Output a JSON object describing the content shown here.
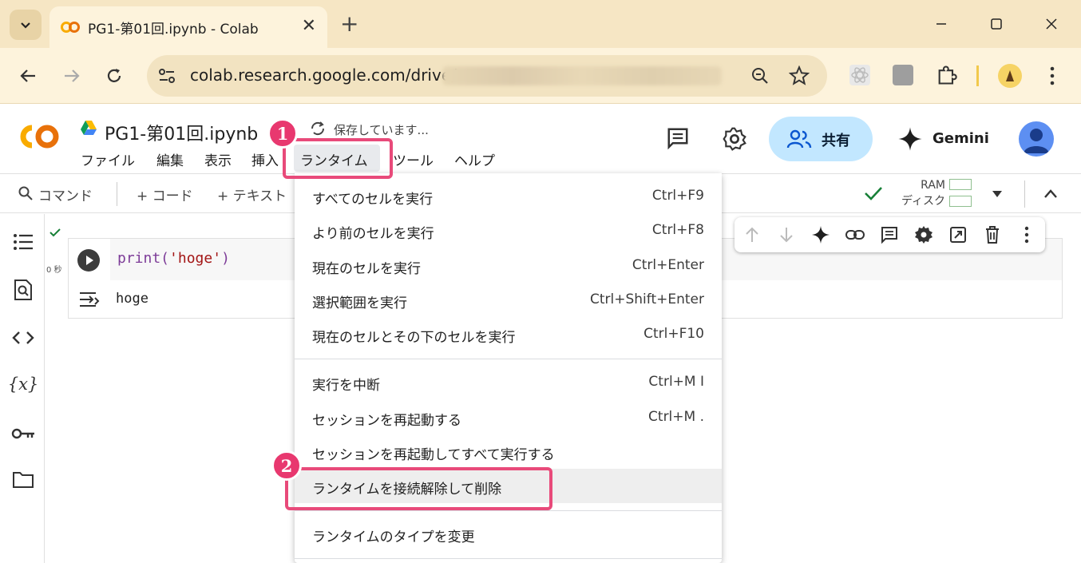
{
  "browser": {
    "tab_title": "PG1-第01回.ipynb - Colab",
    "url": "colab.research.google.com/drive/"
  },
  "notebook": {
    "title": "PG1-第01回.ipynb",
    "saving_status": "保存しています...",
    "menus": [
      "ファイル",
      "編集",
      "表示",
      "挿入",
      "ランタイム",
      "ツール",
      "ヘルプ"
    ],
    "share_label": "共有",
    "gemini_label": "Gemini"
  },
  "toolbar": {
    "command": "コマンド",
    "code": "+ コード",
    "text": "+ テキスト",
    "ram": "RAM",
    "disk": "ディスク"
  },
  "cell": {
    "exec_time": "0 秒",
    "code_fn": "print(",
    "code_str": "'hoge'",
    "code_end": ")",
    "output": "hoge"
  },
  "dropdown": {
    "items": [
      {
        "label": "すべてのセルを実行",
        "shortcut": "Ctrl+F9"
      },
      {
        "label": "より前のセルを実行",
        "shortcut": "Ctrl+F8"
      },
      {
        "label": "現在のセルを実行",
        "shortcut": "Ctrl+Enter"
      },
      {
        "label": "選択範囲を実行",
        "shortcut": "Ctrl+Shift+Enter"
      },
      {
        "label": "現在のセルとその下のセルを実行",
        "shortcut": "Ctrl+F10"
      },
      {
        "label": "実行を中断",
        "shortcut": "Ctrl+M I"
      },
      {
        "label": "セッションを再起動する",
        "shortcut": "Ctrl+M ."
      },
      {
        "label": "セッションを再起動してすべて実行する",
        "shortcut": ""
      },
      {
        "label": "ランタイムを接続解除して削除",
        "shortcut": ""
      },
      {
        "label": "ランタイムのタイプを変更",
        "shortcut": ""
      }
    ]
  },
  "annotations": {
    "step1": "1",
    "step2": "2",
    "color": "#e8386f"
  },
  "colors": {
    "share_bg": "#c2e7ff",
    "avatar": "#5d8ff2",
    "tab_strip": "#f6e6c4"
  }
}
